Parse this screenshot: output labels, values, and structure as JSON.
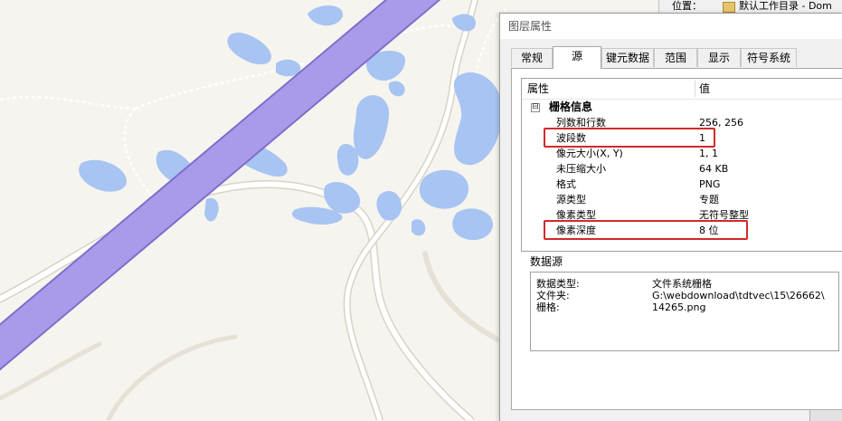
{
  "background_window": {
    "location_label": "位置：",
    "location_value": "默认工作目录 - Dom"
  },
  "dialog": {
    "title": "图层属性",
    "tabs": [
      {
        "label": "常规"
      },
      {
        "label": "源",
        "active": true
      },
      {
        "label": "键元数据"
      },
      {
        "label": "范围"
      },
      {
        "label": "显示"
      },
      {
        "label": "符号系统"
      }
    ],
    "property_table": {
      "header_property": "属性",
      "header_value": "值",
      "group_label": "栅格信息",
      "expander_glyph": "⊟",
      "rows": [
        {
          "key": "列数和行数",
          "value": "256, 256"
        },
        {
          "key": "波段数",
          "value": "1",
          "highlighted": true
        },
        {
          "key": "像元大小(X, Y)",
          "value": "1, 1"
        },
        {
          "key": "未压缩大小",
          "value": "64 KB"
        },
        {
          "key": "格式",
          "value": "PNG"
        },
        {
          "key": "源类型",
          "value": "专题"
        },
        {
          "key": "像素类型",
          "value": "无符号整型"
        },
        {
          "key": "像素深度",
          "value": "8 位",
          "highlighted": true
        }
      ]
    },
    "data_source": {
      "label": "数据源",
      "rows": [
        {
          "key": "数据类型:",
          "value": "文件系统栅格"
        },
        {
          "key": "文件夹:",
          "value": "G:\\webdownload\\tdtvec\\15\\26662\\"
        },
        {
          "key": "栅格:",
          "value": "14265.png"
        }
      ]
    }
  },
  "colors": {
    "map_bg": "#f6f4ee",
    "water": "#a7c4f2",
    "highway": "#ab9aea",
    "road_casing": "#d9d3c6",
    "highlight": "#d22a2a"
  }
}
